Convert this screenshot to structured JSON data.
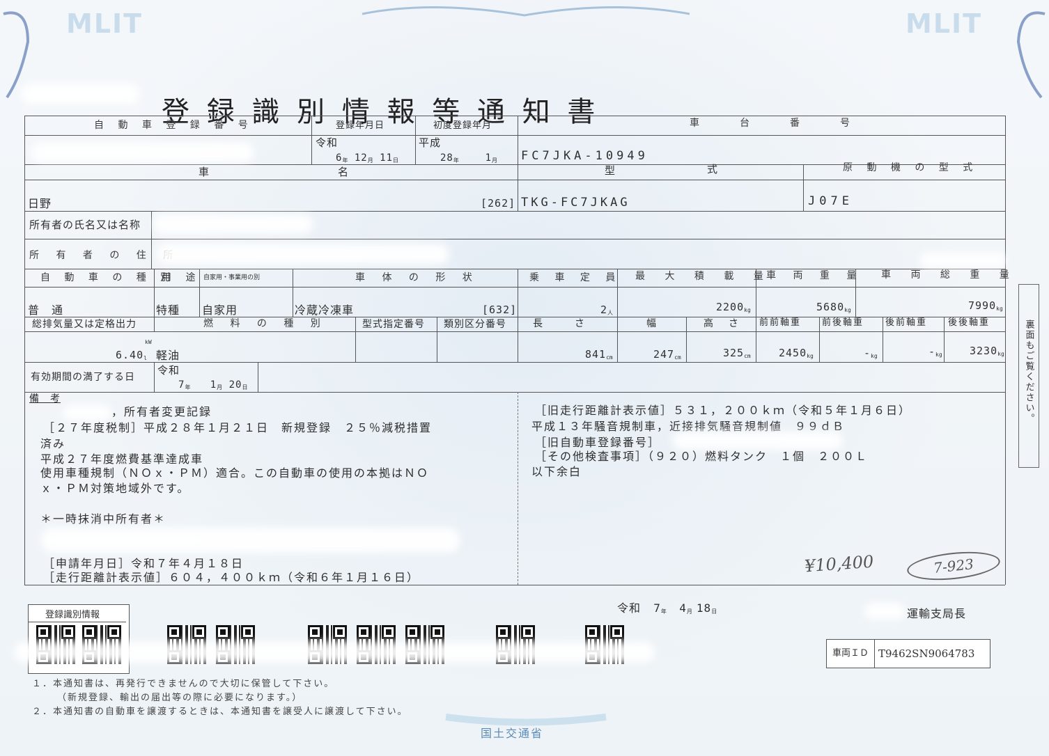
{
  "logos": {
    "left": "MLIT",
    "right": "MLIT",
    "bottom": "国土交通省"
  },
  "title": "登 録 識 別 情 報 等 通 知 書",
  "labels": {
    "reg_number": "自 動 車 登 録 番 号",
    "reg_date": "登録年月日",
    "first_reg": "初度登録年月",
    "chassis": "車　　台　　番　　号",
    "car": "車",
    "name": "名",
    "model": "型",
    "shiki": "式",
    "engine_model": "原 動 機 の 型 式",
    "owner_name": "所有者の氏名又は名称",
    "owner_address": "所 有 者 の 住 所",
    "vehicle_type": "自 動 車 の 種 別",
    "purpose": "用 途",
    "private_business": "自家用・事業用の別",
    "body_shape": "車 体 の 形 状",
    "capacity": "乗 車 定 員",
    "max_load": "最 大 積 載 量",
    "vehicle_weight": "車 両 重 量",
    "gross_weight": "車 両 総 重 量",
    "displacement": "総排気量又は定格出力",
    "fuel_type": "燃 料 の 種 別",
    "type_designation": "型式指定番号",
    "category_number": "類別区分番号",
    "length": "長　　さ",
    "width": "幅",
    "height": "高　さ",
    "ff_axle": "前前軸重",
    "fr_axle": "前後軸重",
    "rf_axle": "後前軸重",
    "rr_axle": "後後軸重",
    "expiry": "有効期間の満了する日",
    "remarks": "備　考"
  },
  "values": {
    "reg_era": "令和",
    "reg_y": "6",
    "reg_m": "12",
    "reg_d": "11",
    "first_era": "平成",
    "first_y": "28",
    "first_m": "1",
    "chassis": "FC7JKA-10949",
    "car_name": "日野",
    "car_name_code": "[262]",
    "model": "TKG-FC7JKAG",
    "engine_model": "J07E",
    "vehicle_type": "普　通",
    "purpose": "特種",
    "private_business": "自家用",
    "body_shape": "冷蔵冷凍車",
    "body_code": "[632]",
    "capacity": "2",
    "max_load": "2200",
    "vehicle_weight": "5680",
    "gross_weight": "7990",
    "displacement": "6.40",
    "fuel": "軽油",
    "length": "841",
    "width": "247",
    "height": "325",
    "ff_axle": "2450",
    "fr_axle": "-",
    "rf_axle": "-",
    "rr_axle": "3230",
    "expiry_era": "令和",
    "expiry_y": "7",
    "expiry_m": "1",
    "expiry_d": "20"
  },
  "units": {
    "nen": "年",
    "tsuki": "月",
    "hi": "日",
    "kw": "kW",
    "l": "l",
    "nin": "人",
    "kg": "kg",
    "cm": "cm"
  },
  "remarks_left": [
    "，所有者変更記録",
    "［２７年度税制］平成２８年１月２１日　新規登録　２５％減税措置",
    "済み",
    "平成２７年度燃費基準達成車",
    "使用車種規制（ＮＯｘ・ＰＭ）適合。この自動車の使用の本拠はＮＯ",
    "ｘ・ＰＭ対策地域外です。",
    "",
    "＊一時抹消中所有者＊",
    "",
    "［申請年月日］令和７年４月１８日",
    "［走行距離計表示値］６０４，４００ｋｍ（令和６年１月１６日）"
  ],
  "remarks_right": [
    "［旧走行距離計表示値］５３１，２００ｋｍ（令和５年１月６日）",
    "平成１３年騒音規制車，近接排気騒音規制値　９９ｄＢ",
    "［旧自動車登録番号］",
    "［その他検査事項］（９２０）燃料タンク　１個　２００Ｌ",
    "以下余白"
  ],
  "handwriting": {
    "price": "¥10,400",
    "circled": "7-923"
  },
  "side_note": "裏面もご覧ください。",
  "issue": {
    "era": "令和",
    "y": "7",
    "m": "4",
    "d": "18",
    "issuer": "運輸支局長"
  },
  "qr_label": "登録識別情報",
  "vehicle_id": {
    "label": "車両ＩＤ",
    "value": "T9462SN9064783"
  },
  "footnotes": [
    "１．本通知書は、再発行できませんので大切に保管して下さい。",
    "（新規登録、輸出の届出等の際に必要になります。）",
    "２．本通知書の自動車を譲渡するときは、本通知書を譲受人に譲渡して下さい。"
  ]
}
